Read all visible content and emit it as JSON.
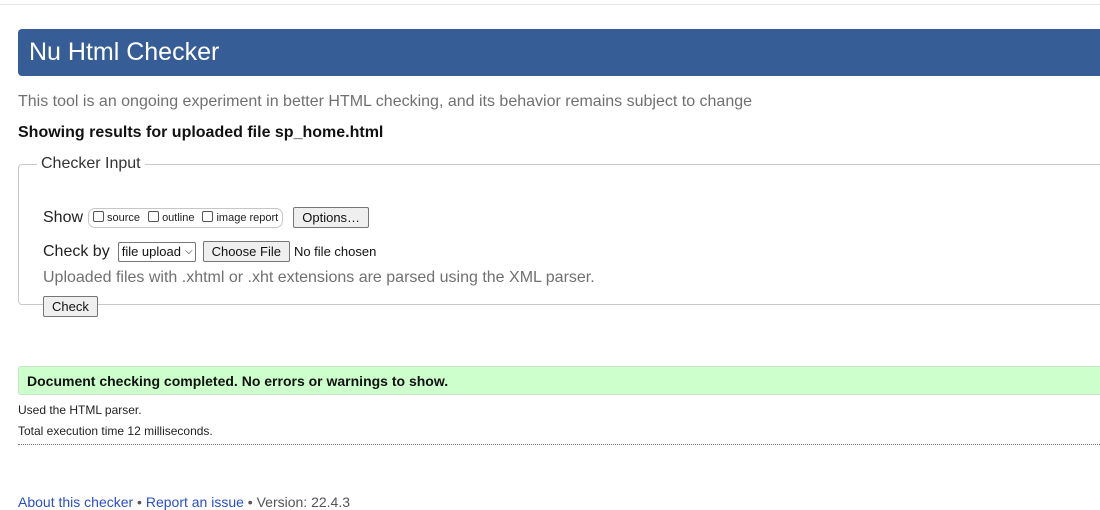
{
  "header": {
    "title": "Nu Html Checker"
  },
  "intro": "This tool is an ongoing experiment in better HTML checking, and its behavior remains subject to change",
  "results_for": "Showing results for uploaded file sp_home.html",
  "checker_input": {
    "legend": "Checker Input",
    "show_label": "Show",
    "show_options": [
      {
        "label": "source",
        "checked": false
      },
      {
        "label": "outline",
        "checked": false
      },
      {
        "label": "image report",
        "checked": false
      }
    ],
    "options_button": "Options…",
    "check_by_label": "Check by",
    "check_by_selected": "file upload",
    "choose_file_button": "Choose File",
    "file_status": "No file chosen",
    "note": "Uploaded files with .xhtml or .xht extensions are parsed using the XML parser.",
    "check_button": "Check"
  },
  "result": {
    "message": "Document checking completed. No errors or warnings to show.",
    "parser": "Used the HTML parser.",
    "execution_time": "Total execution time 12 milliseconds."
  },
  "footer": {
    "about_link": "About this checker",
    "sep1": " • ",
    "report_link": "Report an issue",
    "sep2": " • ",
    "version": "Version: 22.4.3"
  },
  "colors": {
    "header_bg": "#365d95",
    "success_bg": "#ccffcc",
    "link": "#2a4ec8"
  }
}
